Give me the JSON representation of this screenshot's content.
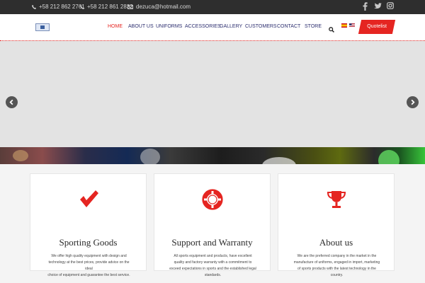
{
  "topbar": {
    "phone1": "+58 212 862 2761",
    "phone2": "+58 212 861 2832",
    "email": "dezuca@hotmail.com",
    "social": [
      "facebook-icon",
      "twitter-icon",
      "instagram-icon"
    ]
  },
  "nav": {
    "items": [
      "HOME",
      "ABOUT US",
      "UNIFORMS",
      "ACCESSORIES",
      "GALLERY",
      "CUSTOMERS",
      "CONTACT",
      "STORE"
    ],
    "active": "HOME",
    "languages": [
      "spanish-flag-icon",
      "english-flag-icon"
    ],
    "quotelist_label": "Quotelist"
  },
  "colors": {
    "accent": "#e52521",
    "nav_text": "#2b2d6e",
    "topbar_bg": "#2e2e2e",
    "slider_bg": "#e3e3e3"
  },
  "slider": {
    "prev_icon": "chevron-left-icon",
    "next_icon": "chevron-right-icon"
  },
  "cards": [
    {
      "icon": "checkmark-icon",
      "title": "Sporting Goods",
      "lines": [
        "We offer high quality equipment with design and",
        "technology at the best prices, provide advice on the ideal",
        "choice of equipment and guarantee the best service."
      ]
    },
    {
      "icon": "lifebuoy-icon",
      "title": "Support and Warranty",
      "lines": [
        "All sports equipment and products, have excellent",
        "quality and factory warranty with a commitment to",
        "exceed expectations in sports and the established legal",
        "standards."
      ]
    },
    {
      "icon": "trophy-icon",
      "title": "About us",
      "lines": [
        "We are the preferred company in the market in the",
        "manufacture of uniforms, engaged in import, marketing",
        "of sports products with the latest technology in the",
        "country."
      ]
    }
  ]
}
